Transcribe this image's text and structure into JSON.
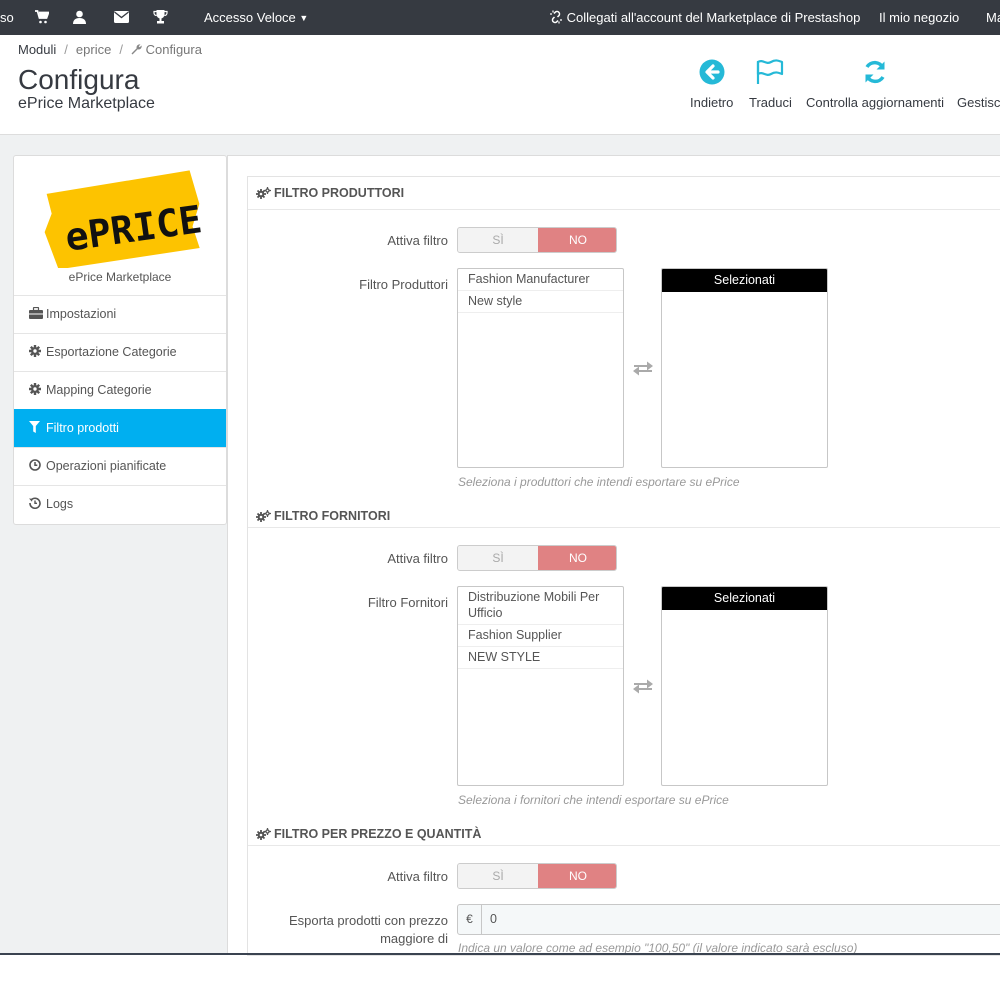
{
  "topbar": {
    "cut_left": "so",
    "quick_access": "Accesso Veloce",
    "marketplace_link": "Collegati all'account del Marketplace di Prestashop",
    "my_shop": "Il mio negozio",
    "cut_right": "Ma"
  },
  "breadcrumb": [
    "Moduli",
    "eprice",
    "Configura"
  ],
  "header": {
    "title": "Configura",
    "subtitle": "ePrice Marketplace"
  },
  "toolbar": {
    "back": "Indietro",
    "translate": "Traduci",
    "check_updates": "Controlla aggiornamenti",
    "manage": "Gestisci"
  },
  "sidebar": {
    "logo_text": "ePRICE",
    "caption": "ePrice Marketplace",
    "items": [
      {
        "label": "Impostazioni",
        "icon": "briefcase-icon"
      },
      {
        "label": "Esportazione Categorie",
        "icon": "gear-icon"
      },
      {
        "label": "Mapping Categorie",
        "icon": "gear-icon"
      },
      {
        "label": "Filtro prodotti",
        "icon": "filter-icon",
        "active": true
      },
      {
        "label": "Operazioni pianificate",
        "icon": "clock-icon"
      },
      {
        "label": "Logs",
        "icon": "history-icon"
      }
    ]
  },
  "switch_labels": {
    "yes": "SÌ",
    "no": "NO"
  },
  "selected_label": "Selezionati",
  "sections": {
    "producers": {
      "heading": "FILTRO PRODUTTORI",
      "active_label": "Attiva filtro",
      "filter_label": "Filtro Produttori",
      "options": [
        "Fashion Manufacturer",
        "New style"
      ],
      "help": "Seleziona i produttori che intendi esportare su ePrice"
    },
    "suppliers": {
      "heading": "FILTRO FORNITORI",
      "active_label": "Attiva filtro",
      "filter_label": "Filtro Fornitori",
      "options": [
        "Distribuzione Mobili Per Ufficio",
        "Fashion Supplier",
        "NEW STYLE"
      ],
      "help": "Seleziona i fornitori che intendi esportare su ePrice"
    },
    "price": {
      "heading": "FILTRO PER PREZZO E QUANTITÀ",
      "active_label": "Attiva filtro",
      "price_label_1": "Esporta prodotti con prezzo",
      "price_label_2": "maggiore di",
      "currency": "€",
      "price_value": "0",
      "help": "Indica un valore come ad esempio \"100,50\" (il valore indicato sarà escluso)"
    }
  },
  "colors": {
    "topbar": "#363a41",
    "accent": "#00aff0",
    "toolbar_icon": "#25b9d7",
    "switch_no": "#e08283",
    "logo_yellow": "#fdc300"
  }
}
